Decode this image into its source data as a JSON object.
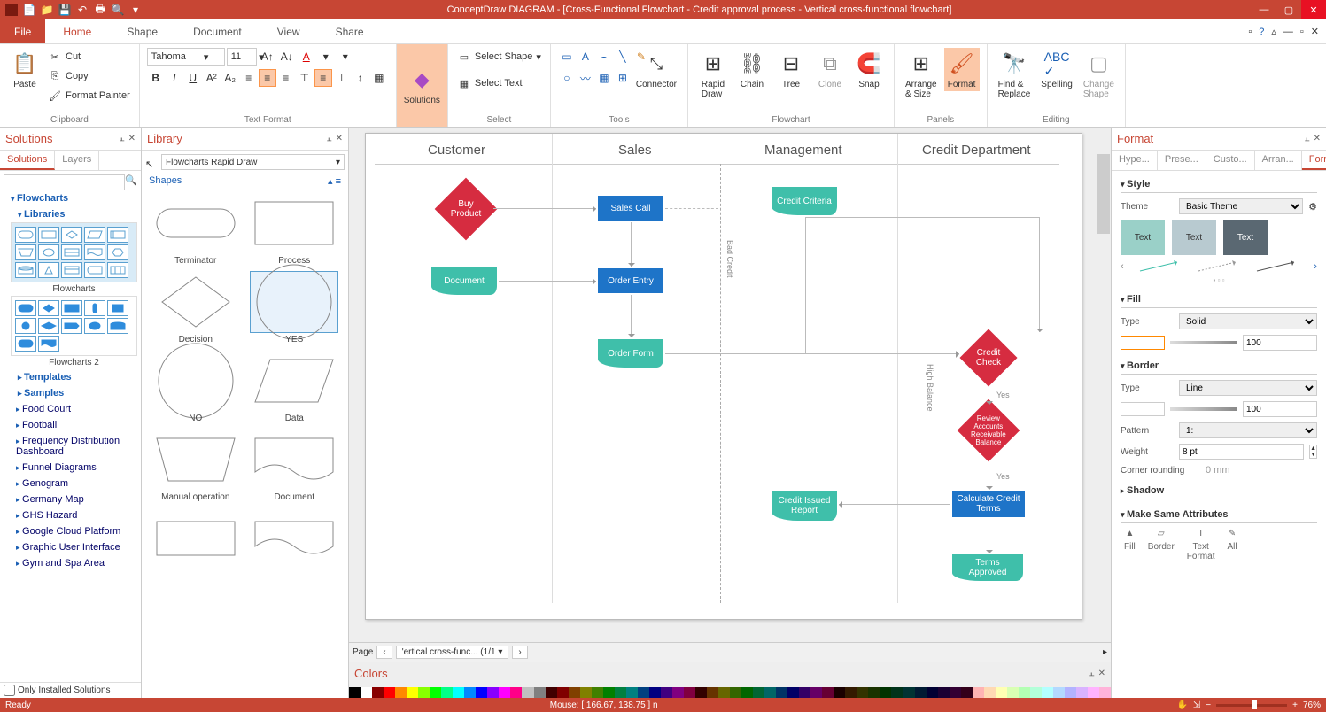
{
  "titlebar": {
    "title": "ConceptDraw DIAGRAM - [Cross-Functional Flowchart - Credit approval process - Vertical cross-functional flowchart]"
  },
  "menu": {
    "file": "File",
    "tabs": [
      "Home",
      "Shape",
      "Document",
      "View",
      "Share"
    ],
    "active_tab": "Home"
  },
  "ribbon": {
    "clipboard": {
      "paste": "Paste",
      "cut": "Cut",
      "copy": "Copy",
      "format_painter": "Format Painter",
      "label": "Clipboard"
    },
    "text_format": {
      "font": "Tahoma",
      "size": "11",
      "label": "Text Format"
    },
    "solutions": {
      "label": "Solutions"
    },
    "select": {
      "select_shape": "Select Shape",
      "select_text": "Select Text",
      "label": "Select"
    },
    "tools": {
      "connector": "Connector",
      "label": "Tools"
    },
    "flowchart": {
      "rapid_draw": "Rapid\nDraw",
      "chain": "Chain",
      "tree": "Tree",
      "clone": "Clone",
      "snap": "Snap",
      "label": "Flowchart"
    },
    "panels": {
      "arrange": "Arrange\n& Size",
      "format": "Format",
      "label": "Panels"
    },
    "editing": {
      "find_replace": "Find &\nReplace",
      "spelling": "Spelling",
      "change_shape": "Change\nShape",
      "label": "Editing"
    }
  },
  "solutions_panel": {
    "title": "Solutions",
    "tabs": [
      "Solutions",
      "Layers"
    ],
    "flowcharts": "Flowcharts",
    "libraries": "Libraries",
    "grid1_label": "Flowcharts",
    "grid2_label": "Flowcharts 2",
    "templates": "Templates",
    "samples": "Samples",
    "items": [
      "Food Court",
      "Football",
      "Frequency Distribution Dashboard",
      "Funnel Diagrams",
      "Genogram",
      "Germany Map",
      "GHS Hazard",
      "Google Cloud Platform",
      "Graphic User Interface",
      "Gym and Spa Area"
    ],
    "only_installed": "Only Installed Solutions"
  },
  "library_panel": {
    "title": "Library",
    "selector": "Flowcharts Rapid Draw",
    "shapes_hdr": "Shapes",
    "shapes": [
      "Terminator",
      "Process",
      "Decision",
      "YES",
      "NO",
      "Data",
      "Manual operation",
      "Document"
    ]
  },
  "canvas": {
    "lanes": [
      "Customer",
      "Sales",
      "Management",
      "Credit Department"
    ],
    "nodes": {
      "buy_product": "Buy Product",
      "sales_call": "Sales Call",
      "credit_criteria": "Credit Criteria",
      "document": "Document",
      "order_entry": "Order Entry",
      "order_form": "Order Form",
      "credit_check": "Credit Check",
      "review_balance": "Review\nAccounts\nReceivable\nBalance",
      "calc_terms": "Calculate Credit\nTerms",
      "credit_report": "Credit Issued\nReport",
      "terms_approved": "Terms Approved"
    },
    "labels": {
      "bad_credit": "Bad Credit",
      "high_balance": "High Balance",
      "yes1": "Yes",
      "yes2": "Yes"
    },
    "page_label": "Page",
    "page_tab": "'ertical cross-func...  (1/1"
  },
  "colors_panel": {
    "title": "Colors"
  },
  "format_panel": {
    "title": "Format",
    "tabs": [
      "Hype...",
      "Prese...",
      "Custo...",
      "Arran...",
      "Format"
    ],
    "style": "Style",
    "theme_label": "Theme",
    "theme_value": "Basic Theme",
    "text_chip": "Text",
    "fill": "Fill",
    "fill_type": "Type",
    "fill_type_value": "Solid",
    "opacity": "100",
    "border": "Border",
    "border_type": "Type",
    "border_type_value": "Line",
    "border_opacity": "100",
    "pattern": "Pattern",
    "pattern_value": "1:",
    "weight": "Weight",
    "weight_value": "8 pt",
    "corner": "Corner rounding",
    "corner_value": "0 mm",
    "shadow": "Shadow",
    "same_attr": "Make Same Attributes",
    "same_items": [
      "Fill",
      "Border",
      "Text\nFormat",
      "All"
    ]
  },
  "statusbar": {
    "ready": "Ready",
    "mouse": "Mouse: [ 166.67, 138.75 ] n",
    "zoom": "76%"
  },
  "color_palette": [
    "#000",
    "#fff",
    "#800",
    "#f00",
    "#f80",
    "#ff0",
    "#8f0",
    "#0f0",
    "#0f8",
    "#0ff",
    "#08f",
    "#00f",
    "#80f",
    "#f0f",
    "#f08",
    "#c0c0c0",
    "#808080",
    "#400000",
    "#800000",
    "#804000",
    "#808000",
    "#408000",
    "#008000",
    "#008040",
    "#008080",
    "#004080",
    "#000080",
    "#400080",
    "#800080",
    "#800040",
    "#330000",
    "#663300",
    "#666600",
    "#336600",
    "#006600",
    "#006633",
    "#006666",
    "#003366",
    "#000066",
    "#330066",
    "#660066",
    "#660033",
    "#1a0000",
    "#331a00",
    "#333300",
    "#1a3300",
    "#003300",
    "#00331a",
    "#003333",
    "#001a33",
    "#000033",
    "#1a0033",
    "#330033",
    "#33001a",
    "#ffb3b3",
    "#ffd9b3",
    "#ffffb3",
    "#d9ffb3",
    "#b3ffb3",
    "#b3ffd9",
    "#b3ffff",
    "#b3d9ff",
    "#b3b3ff",
    "#d9b3ff",
    "#ffb3ff",
    "#ffb3d9"
  ]
}
